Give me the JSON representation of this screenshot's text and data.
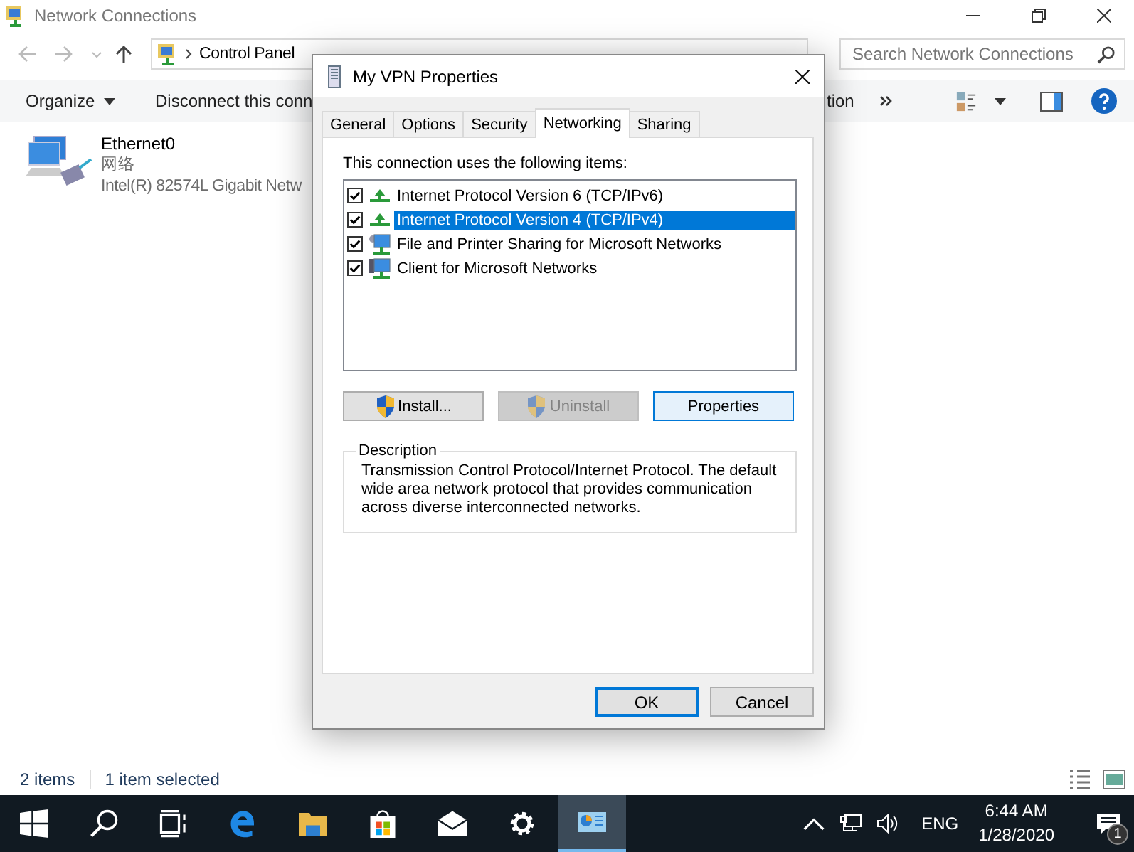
{
  "window": {
    "title": "Network Connections"
  },
  "address": {
    "crumbs": [
      "Control Panel"
    ],
    "search_placeholder": "Search Network Connections"
  },
  "toolbar": [
    {
      "label": "Organize",
      "kind": "menu"
    },
    {
      "label": "Disconnect this conn",
      "kind": "command"
    },
    {
      "label": "tion",
      "kind": "command"
    }
  ],
  "connections": [
    {
      "name": "Ethernet0",
      "network": "网络",
      "adapter": "Intel(R) 82574L Gigabit Netw"
    }
  ],
  "status_bar": [
    "2 items",
    "1 item selected"
  ],
  "dialog": {
    "title": "My VPN Properties",
    "tabs": [
      {
        "label": "General",
        "selected": false
      },
      {
        "label": "Options",
        "selected": false
      },
      {
        "label": "Security",
        "selected": false
      },
      {
        "label": "Networking",
        "selected": true
      },
      {
        "label": "Sharing",
        "selected": false
      }
    ],
    "caption": "This connection uses the following items:",
    "items": [
      {
        "label": "Internet Protocol Version 6 (TCP/IPv6)",
        "checked": true,
        "selected": false,
        "kind": "protocol"
      },
      {
        "label": "Internet Protocol Version 4 (TCP/IPv4)",
        "checked": true,
        "selected": true,
        "kind": "protocol"
      },
      {
        "label": "File and Printer Sharing for Microsoft Networks",
        "checked": true,
        "selected": false,
        "kind": "service"
      },
      {
        "label": "Client for Microsoft Networks",
        "checked": true,
        "selected": false,
        "kind": "client"
      }
    ],
    "buttons": [
      {
        "label": "Install...",
        "disabled": false,
        "focused": false,
        "shield": true
      },
      {
        "label": "Uninstall",
        "disabled": true,
        "focused": false,
        "shield": true
      },
      {
        "label": "Properties",
        "disabled": false,
        "focused": true,
        "shield": false
      }
    ],
    "description": {
      "heading": "Description",
      "text": "Transmission Control Protocol/Internet Protocol. The default wide area network protocol that provides communication across diverse interconnected networks."
    },
    "footer_buttons": [
      {
        "label": "OK",
        "default": true
      },
      {
        "label": "Cancel",
        "default": false
      }
    ]
  },
  "taskbar": {
    "apps": [
      {
        "kind": "start",
        "active": false
      },
      {
        "kind": "search",
        "active": false
      },
      {
        "kind": "taskview",
        "active": false
      },
      {
        "kind": "edge",
        "active": false
      },
      {
        "kind": "folder",
        "active": false
      },
      {
        "kind": "store",
        "active": false
      },
      {
        "kind": "mail",
        "active": false
      },
      {
        "kind": "settings",
        "active": false
      },
      {
        "kind": "network",
        "active": true
      }
    ],
    "language": "ENG",
    "time": "6:44 AM",
    "date": "1/28/2020",
    "notifications": "1"
  }
}
